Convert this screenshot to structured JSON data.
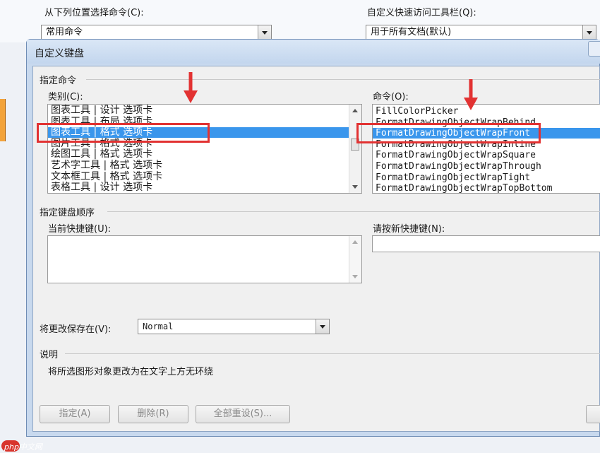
{
  "background": {
    "choose_from_label": "从下列位置选择命令(C):",
    "choose_from_value": "常用命令",
    "qat_label": "自定义快速访问工具栏(Q):",
    "qat_value": "用于所有文档(默认)"
  },
  "dialog": {
    "title": "自定义键盘",
    "specify_command_group": "指定命令",
    "categories_label": "类别(C):",
    "categories": [
      "图表工具 | 设计 选项卡",
      "图表工具 | 布局 选项卡",
      "图表工具 | 格式 选项卡",
      "图片工具 | 格式 选项卡",
      "绘图工具 | 格式 选项卡",
      "艺术字工具 | 格式 选项卡",
      "文本框工具 | 格式 选项卡",
      "表格工具 | 设计 选项卡"
    ],
    "selected_category_index": 2,
    "commands_label": "命令(O):",
    "commands": [
      "FillColorPicker",
      "FormatDrawingObjectWrapBehind",
      "FormatDrawingObjectWrapFront",
      "FormatDrawingObjectWrapInline",
      "FormatDrawingObjectWrapSquare",
      "FormatDrawingObjectWrapThrough",
      "FormatDrawingObjectWrapTight",
      "FormatDrawingObjectWrapTopBottom"
    ],
    "selected_command_index": 2,
    "keyboard_sequence_group": "指定键盘顺序",
    "current_keys_label": "当前快捷键(U):",
    "new_key_label": "请按新快捷键(N):",
    "save_changes_label": "将更改保存在(V):",
    "save_changes_value": "Normal",
    "description_group": "说明",
    "description_text": "将所选图形对象更改为在文字上方无环绕",
    "assign_button": "指定(A)",
    "remove_button": "删除(R)",
    "reset_all_button": "全部重设(S)..."
  },
  "watermark": "php中文网",
  "colors": {
    "highlight": "#3a96ec",
    "annotation": "#e23232"
  }
}
